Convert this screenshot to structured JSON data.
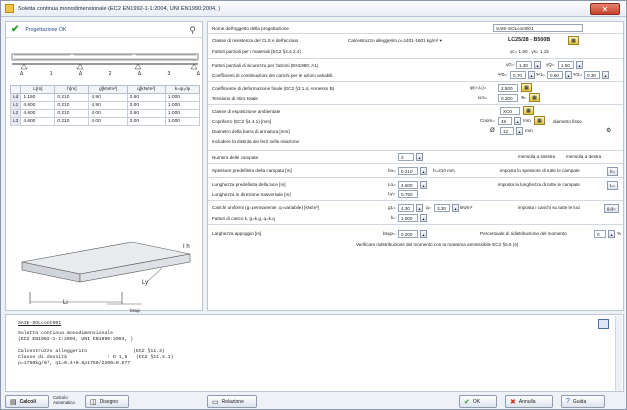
{
  "window": {
    "title": "Soletta continua monodimensionale (EC2 EN1992-1-1:2004, UNI EN1990:2004, )",
    "close_glyph": "✕"
  },
  "left": {
    "status": "Progettazione OK",
    "icons": {
      "check": "checkmark-icon",
      "zoom": "zoom-icon"
    },
    "schema_labels": [
      "Δ",
      "1",
      "Δ",
      "2",
      "Δ",
      "3",
      "Δ"
    ],
    "table": {
      "headers": [
        "",
        "L[m]",
        "h[m]",
        "g[kN/m²]",
        "q[kN/m²]",
        "k=ψ₂/ψ"
      ],
      "rows": [
        [
          "Ld",
          "1.150",
          "0.210",
          "4.90",
          "3.60",
          "1.000"
        ],
        [
          "L1",
          "4.600",
          "0.210",
          "4.90",
          "3.00",
          "1.000"
        ],
        [
          "L2",
          "4.600",
          "0.210",
          "4.00",
          "3.60",
          "1.000"
        ],
        [
          "L3",
          "4.600",
          "0.210",
          "4.00",
          "3.00",
          "1.000"
        ]
      ]
    },
    "slab_labels": {
      "h": "I h",
      "ly": "Ly",
      "li": "Li",
      "bsup": "bsup"
    }
  },
  "right": {
    "nome_label": "Nome dell'oggetto della progettazione",
    "nome_value": "SAIE-SOLcont001",
    "classe_label": "Classe di resistenza del CLS e dell'acciaio",
    "cls_dropdown": "Calcestruzzo alleggerito  ρ=1401-1601 kg/m³  ▾",
    "classe_value": "LC25/28 - B500B",
    "fattori_mat_label": "Fattori parziali per i materiali (EC2 §2.4.2.4)",
    "gamma_c": "γc= 1.50 , γs= 1.15",
    "fattori_az_label": "Fattori parziali di sicurezza per l'azioni (EN1990, A1)",
    "gG_label": "γG=",
    "gG": "1.30",
    "gQ_label": "γQ=",
    "gQ": "1.50",
    "coeff_comb_label": "Coefficienti di combinazioni dei carichi per le azioni variabili",
    "psi0_label": "Ψ0=",
    "psi0": "0.70",
    "psi1_label": "Ψ1=",
    "psi1": "0.60",
    "psi2_label": "Ψ2=",
    "psi2": "0.30",
    "coeff_def_label": "Coefficiente di deformazione finale (EC2 §3.1.4, Annesso B)",
    "phi_label": "φ(∞,t₀)=",
    "phi": "2.500",
    "ritiro_label": "Tensione di ritiro totale",
    "eps_label": "εcs=",
    "eps": "0.300",
    "eps_unit": "‰",
    "esposizione_label": "Classe di esposizione ambientale",
    "esposizione": "XC0",
    "copriferro_label": "Copriferro (EC2 §4.4.1) [mm]",
    "cnom_label": "Cnom=",
    "cnom": "45",
    "cnom_unit": "mm",
    "diam_fisso": "diametro fisso",
    "diametro_label": "Diametro della barra di armatura [mm]",
    "diam_symbol": "Ø",
    "diam": "12",
    "diam_unit": "mm",
    "distinta_label": "Includere la distinta dei ferri nella relazione",
    "campate_label": "Numero delle campate",
    "campate": "3",
    "mensola_sx": "mensola a sinistra",
    "mensola_dx": "mensola a destra",
    "spessore_label": "Spessore predefinito della campata [m]",
    "ho_label": "ho=",
    "ho": "0.210",
    "h_note": "h=210 mm",
    "spessore_btn_label": "imposta lo spessore di tutte le campate",
    "spessore_btn": "h=",
    "lunghezza_label": "Lunghezza predefinita della luce [m]",
    "lo_label": "Lo=",
    "lo": "4.600",
    "lunghezza_btn_label": "imposta la lunghezza di tutte le campate",
    "lunghezza_btn": "L=",
    "lung_trasv_label": "Lunghezza in direzione trasversale [m]",
    "ly_label": "Ly=",
    "ly": "0.750",
    "carichi_label": "Carichi uniformi (g=permanente, q=variabile) [kN/m²]",
    "g_label": "g1=",
    "g": "4.30",
    "q_label": "q=",
    "q": "3.30",
    "q_unit": "kN/m²",
    "carichi_btn_label": "imposta i carichi su tutte le luci",
    "carichi_btn": "g,q=",
    "fattori_carico_label": "Fattori di carico k, g=k.g, q=k.q",
    "k_label": "k=",
    "k": "1.000",
    "appoggio_label": "Larghezza appoggio [m]",
    "bsup_label": "bsup=",
    "bsup": "0.200",
    "ridistr_label": "Percentuale di ridistribuzione del momento",
    "ridistr": "0",
    "ridistr_unit": "%",
    "verifica_label": "Verificare ridistribuzione del momento con la massima ammissibile EC2 §5.5 (4)"
  },
  "report": {
    "title": "SAIE-SOLcont001",
    "lines": [
      "Soletta continua monodimensionale",
      "(EC2 EN1992-1-1:2004, UNI EN1990:2004, )",
      "",
      "Calcestruzzo alleggerito                (EC2 §11.3)",
      "Classe di densità              : D 1,6   (EC2 §11.3.1)",
      "ρ=1750kg/m³, η1=0.4+0.6ρ1750/2200=0.877"
    ]
  },
  "footer": {
    "calcoli": "Calcoli",
    "calcolo_auto": "Calcolo\nAutomatico",
    "disegno": "Disegno",
    "relazione": "Relazione",
    "ok": "OK",
    "annulla": "Annulla",
    "guida": "Guida"
  }
}
